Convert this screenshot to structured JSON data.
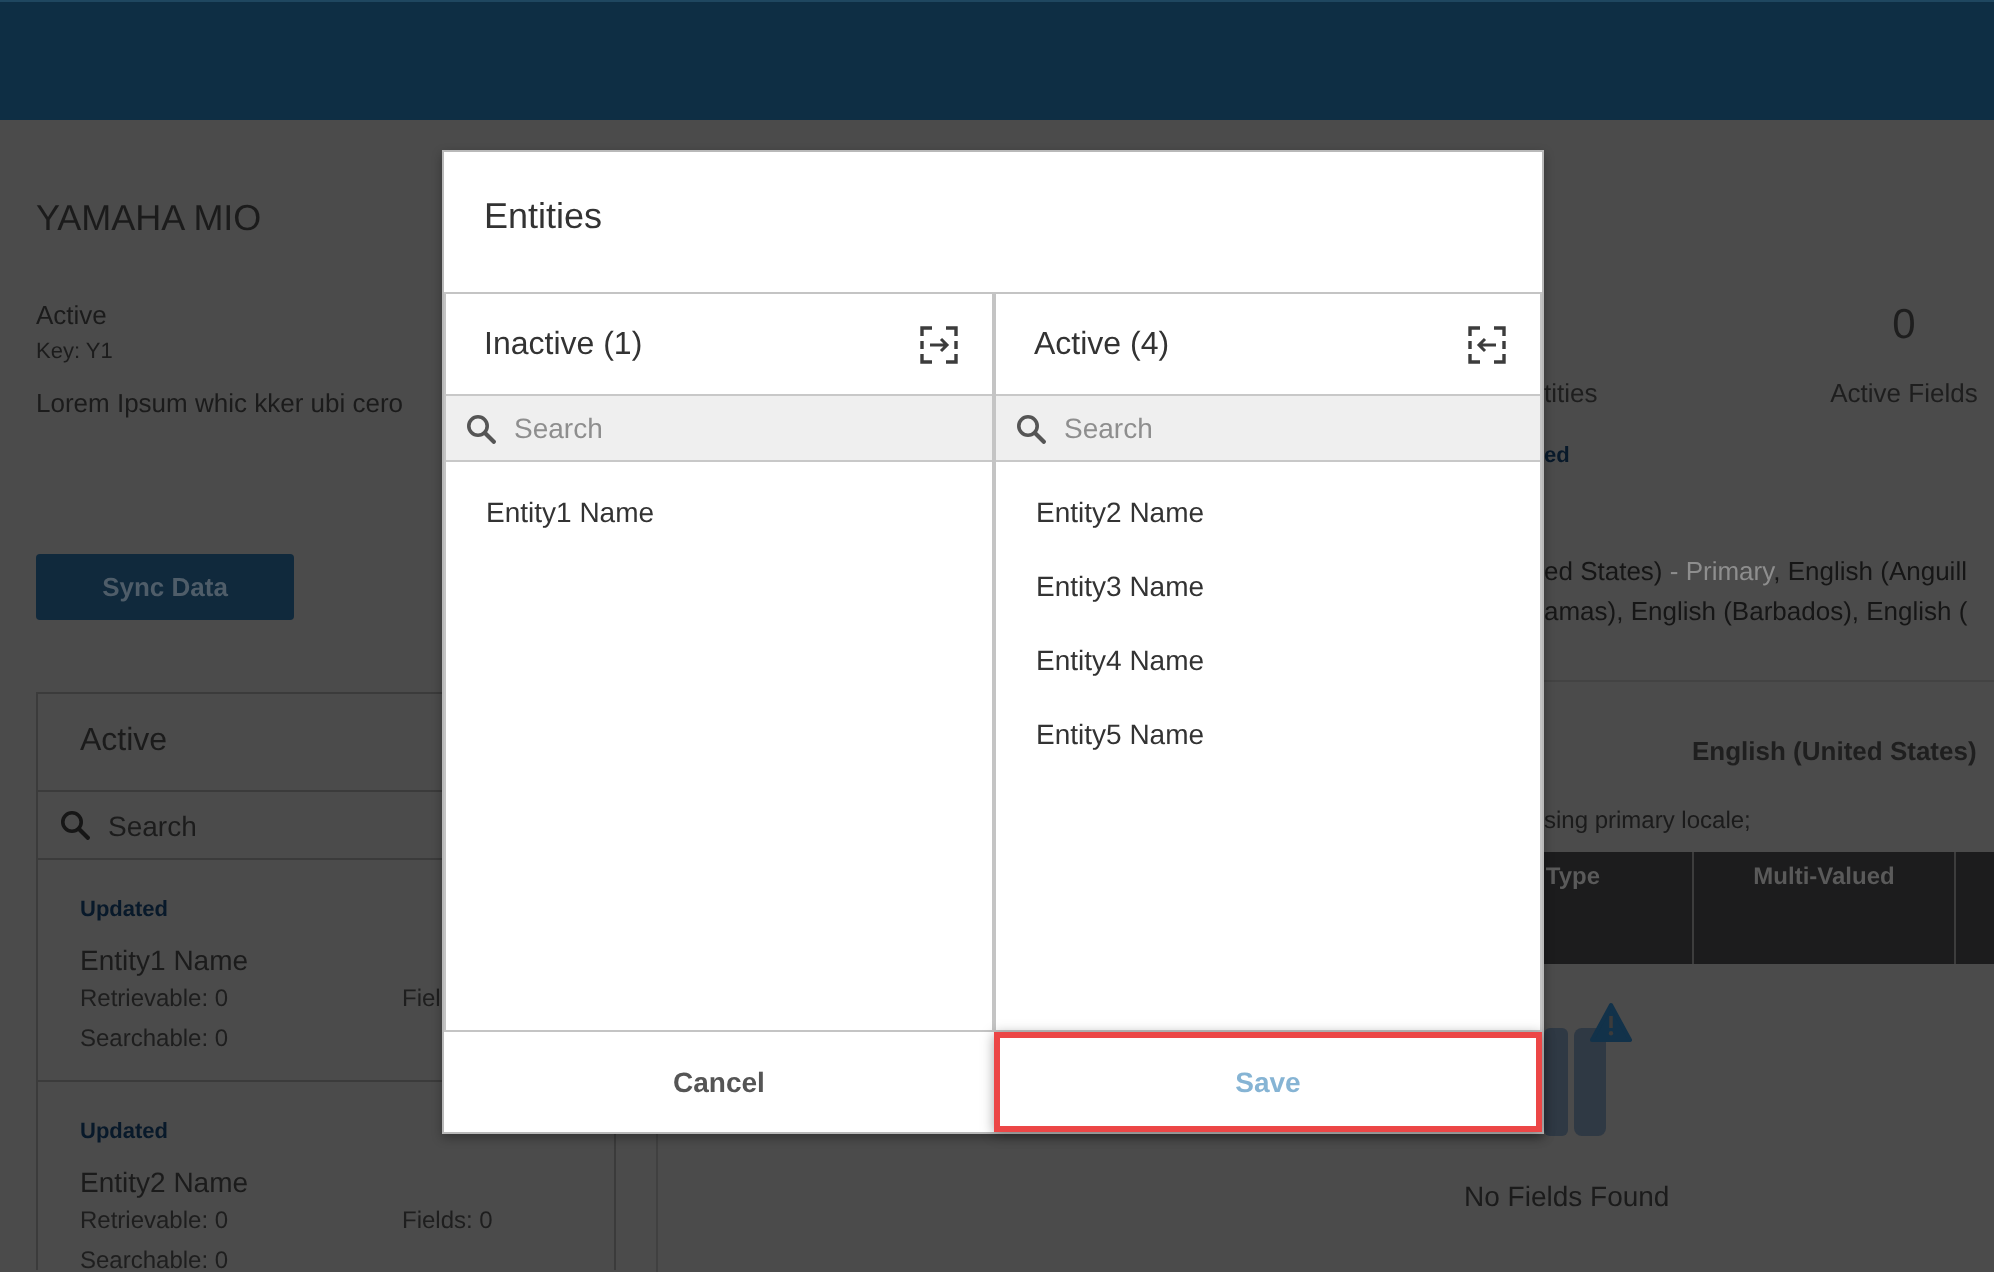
{
  "entity": {
    "title": "YAMAHA MIO",
    "status": "Active",
    "key": "Key: Y1",
    "description": "Lorem Ipsum whic kker ubi cero"
  },
  "sync_button": {
    "label": "Sync Data"
  },
  "entity_list": {
    "title": "Active",
    "search": {
      "placeholder": "Search"
    },
    "items": [
      {
        "badge": "Updated",
        "name": "Entity1 Name",
        "retrievable": "Retrievable: 0",
        "fields": "Fiel",
        "searchable": "Searchable: 0"
      },
      {
        "badge": "Updated",
        "name": "Entity2 Name",
        "retrievable": "Retrievable: 0",
        "fields": "Fields: 0",
        "searchable": "Searchable: 0"
      }
    ]
  },
  "stats": [
    {
      "label": "tities",
      "badge": "ed"
    },
    {
      "value": "0",
      "label": "Active Fields"
    }
  ],
  "locales": [
    [
      {
        "text": "ed States) ",
        "muted": false
      },
      {
        "text": "- Primary",
        "muted": true
      },
      {
        "text": ", English (Anguill",
        "muted": false
      }
    ],
    [
      {
        "text": "amas), English (Barbados), English (",
        "muted": false
      }
    ]
  ],
  "locale_panel": {
    "title": "English (United States)",
    "note": "sing primary locale;",
    "columns": [
      "Type",
      "Multi-Valued"
    ],
    "empty_message": "No Fields Found"
  },
  "dialog": {
    "title": "Entities",
    "lists": [
      {
        "kind": "inactive",
        "title": "Inactive (1)",
        "search": {
          "placeholder": "Search"
        },
        "items": [
          {
            "label": "Entity1 Name",
            "selected": false
          }
        ]
      },
      {
        "kind": "active",
        "title": "Active (4)",
        "search": {
          "placeholder": "Search"
        },
        "items": [
          {
            "label": "Entity2 Name",
            "selected": false
          },
          {
            "label": "Entity3 Name",
            "selected": false
          },
          {
            "label": "Entity4 Name",
            "selected": false
          },
          {
            "label": "Entity5 Name",
            "selected": false
          }
        ]
      }
    ],
    "buttons": [
      {
        "label": "Cancel",
        "disabled": false,
        "highlighted": false
      },
      {
        "label": "Save",
        "disabled": true,
        "highlighted": true
      }
    ]
  }
}
